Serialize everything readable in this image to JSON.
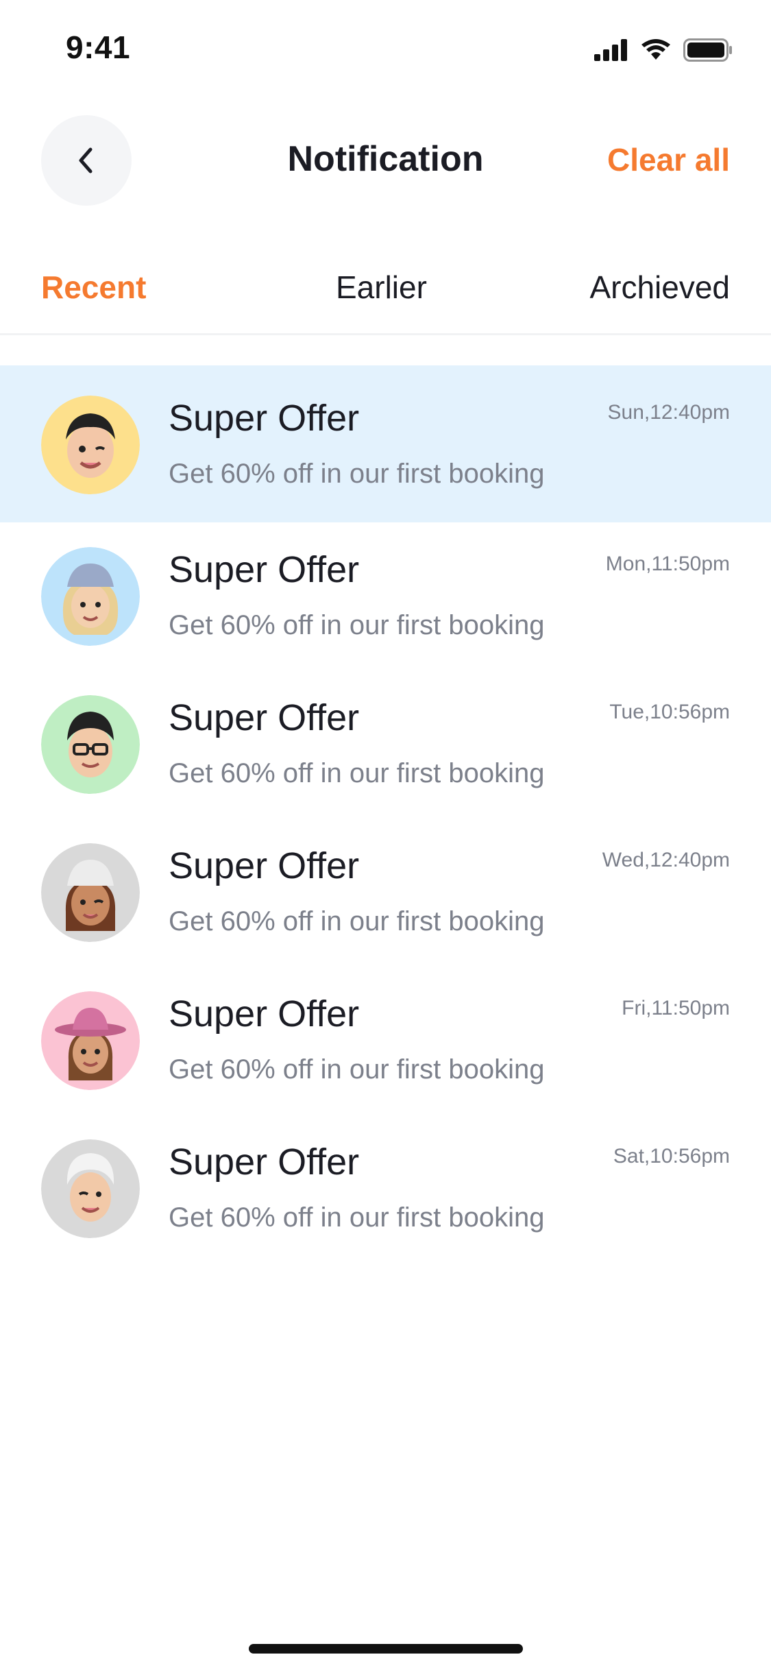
{
  "status_bar": {
    "time": "9:41"
  },
  "header": {
    "title": "Notification",
    "clear_label": "Clear all",
    "back_icon": "chevron-left-icon"
  },
  "tabs": [
    {
      "label": "Recent",
      "active": true
    },
    {
      "label": "Earlier",
      "active": false
    },
    {
      "label": "Archieved",
      "active": false
    }
  ],
  "colors": {
    "accent": "#f57a2f",
    "highlight_row": "#e3f2fd",
    "text_primary": "#1b1c24",
    "text_secondary": "#7c808b"
  },
  "notifications": [
    {
      "title": "Super Offer",
      "body": "Get 60% off in our first booking",
      "time": "Sun,12:40pm",
      "avatar_bg": "#fde08c",
      "highlighted": true
    },
    {
      "title": "Super Offer",
      "body": "Get 60% off in our first booking",
      "time": "Mon,11:50pm",
      "avatar_bg": "#bde3fb",
      "highlighted": false
    },
    {
      "title": "Super Offer",
      "body": "Get 60% off in our first booking",
      "time": "Tue,10:56pm",
      "avatar_bg": "#bfeec3",
      "highlighted": false
    },
    {
      "title": "Super Offer",
      "body": "Get 60% off in our first booking",
      "time": "Wed,12:40pm",
      "avatar_bg": "#d9d9d9",
      "highlighted": false
    },
    {
      "title": "Super Offer",
      "body": "Get 60% off in our first booking",
      "time": "Fri,11:50pm",
      "avatar_bg": "#fbc3d3",
      "highlighted": false
    },
    {
      "title": "Super Offer",
      "body": "Get 60% off in our first booking",
      "time": "Sat,10:56pm",
      "avatar_bg": "#d9d9d9",
      "highlighted": false
    }
  ]
}
